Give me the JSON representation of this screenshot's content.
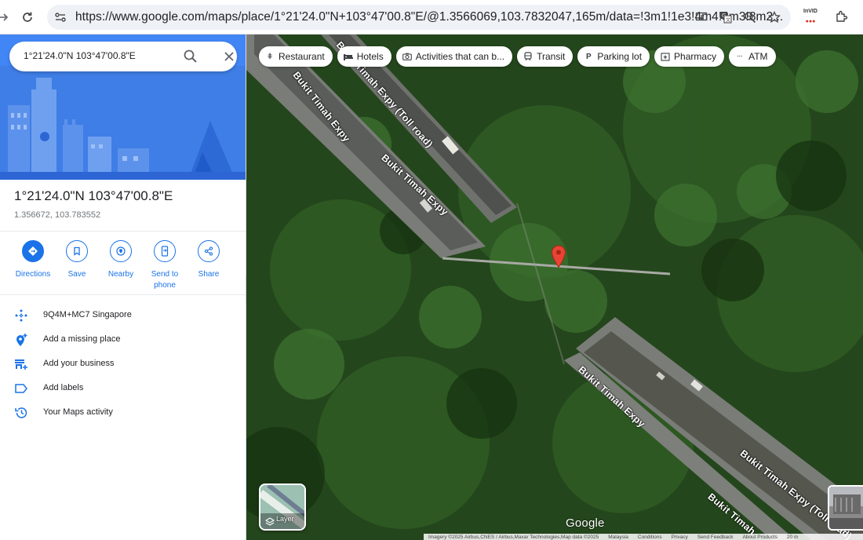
{
  "browser": {
    "url": "https://www.google.com/maps/place/1°21'24.0\"N+103°47'00.8\"E/@1.3566069,103.7832047,165m/data=!3m1!1e3!4m4!3m3!8m2...",
    "ext_label": "InVID"
  },
  "search": {
    "value": "1°21'24.0\"N 103°47'00.8\"E"
  },
  "place": {
    "title": "1°21'24.0\"N 103°47'00.8\"E",
    "coords": "1.356672, 103.783552"
  },
  "actions": [
    {
      "label": "Directions"
    },
    {
      "label": "Save"
    },
    {
      "label": "Nearby"
    },
    {
      "label": "Send to phone"
    },
    {
      "label": "Share"
    }
  ],
  "list": [
    {
      "label": "9Q4M+MC7 Singapore",
      "icon": "plus-code-icon"
    },
    {
      "label": "Add a missing place",
      "icon": "add-place-icon"
    },
    {
      "label": "Add your business",
      "icon": "add-business-icon"
    },
    {
      "label": "Add labels",
      "icon": "label-icon"
    },
    {
      "label": "Your Maps activity",
      "icon": "history-icon"
    }
  ],
  "chips": [
    {
      "label": "Restaurant",
      "icon": "restaurant-icon"
    },
    {
      "label": "Hotels",
      "icon": "hotel-icon"
    },
    {
      "label": "Activities that can b...",
      "icon": "camera-icon"
    },
    {
      "label": "Transit",
      "icon": "transit-icon"
    },
    {
      "label": "Parking lot",
      "icon": "parking-icon"
    },
    {
      "label": "Pharmacy",
      "icon": "pharmacy-icon"
    },
    {
      "label": "ATM",
      "icon": "atm-icon"
    }
  ],
  "map": {
    "road_labels": [
      "Bukit Timah Expy",
      "Bukit Timah Expy (Toll road)",
      "Bukit Timah Expy",
      "Bukit Timah Expy",
      "Bukit Timah Expy (Toll road)",
      "Bukit Timah"
    ],
    "layer_label": "Layer",
    "logo": "Google",
    "footer": [
      "Imagery ©2025 Airbus,CNES / Airbus,Maxar Technologies,Map data ©2025",
      "Malaysia",
      "Conditions",
      "Privacy",
      "Send Feedback",
      "About Products",
      "20 m"
    ]
  },
  "colors": {
    "accent": "#1a73e8",
    "pin": "#ea4335"
  }
}
